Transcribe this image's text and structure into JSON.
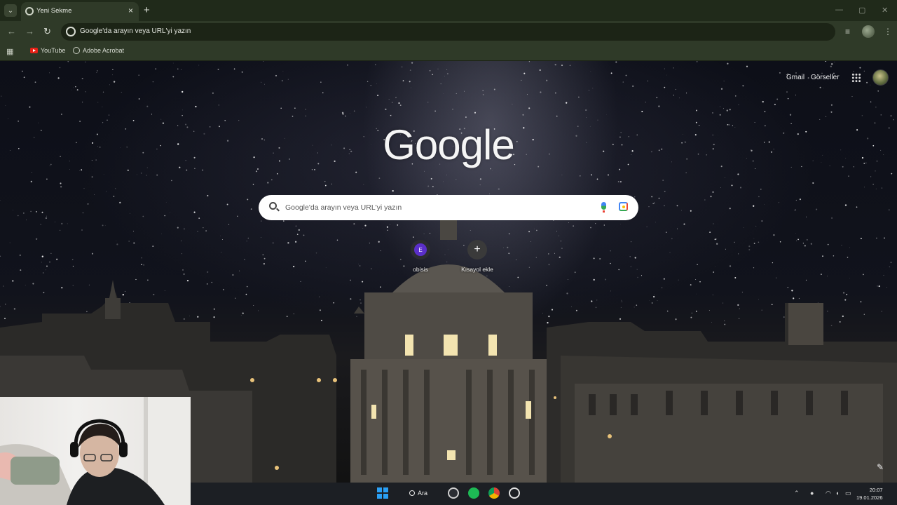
{
  "tab": {
    "title": "Yeni Sekme",
    "close": "×",
    "new_tab": "+"
  },
  "window_controls": {
    "minimize": "—",
    "maximize": "▢",
    "close": "✕"
  },
  "omnibox": {
    "text": "Google'da arayın veya URL'yi yazın"
  },
  "bookmarks": [
    {
      "label": "YouTube",
      "icon": "youtube-icon"
    },
    {
      "label": "Adobe Acrobat",
      "icon": "acrobat-icon"
    }
  ],
  "ntp": {
    "top_links": {
      "gmail": "Gmail",
      "images": "Görseller"
    },
    "logo": "Google",
    "search_placeholder": "Google'da arayın veya URL'yi yazın",
    "shortcuts": [
      {
        "label": "obisis",
        "letter": "E",
        "color": "#5b2fc9"
      },
      {
        "label": "Kısayol ekle",
        "letter": "+",
        "color": "#3a3a3a"
      }
    ]
  },
  "taskbar": {
    "search_label": "Ara",
    "time": "20:07",
    "date": "19.01.2026"
  },
  "colors": {
    "chrome_frame": "#202a1a",
    "chrome_toolbar": "#2f3a28",
    "accent_blue": "#2aa0f5",
    "spotify_green": "#1db954"
  }
}
